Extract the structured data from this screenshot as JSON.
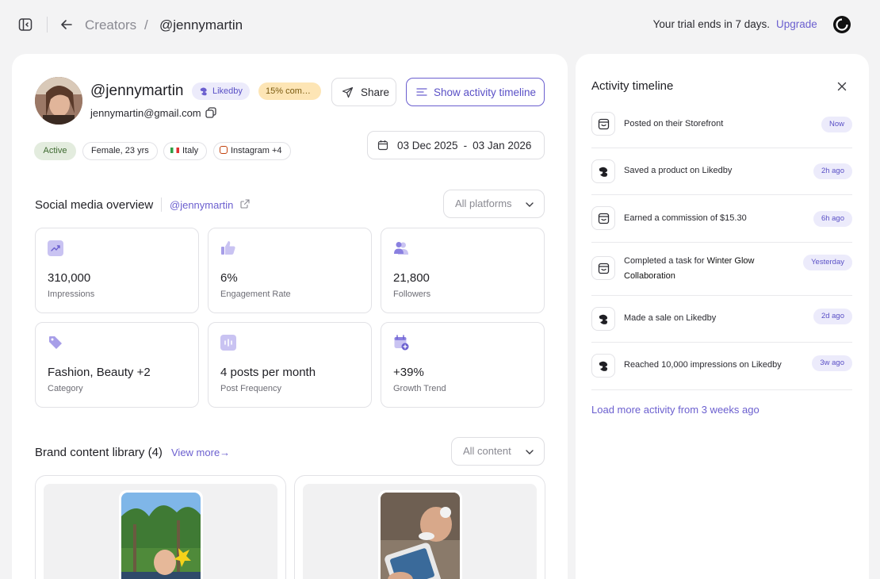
{
  "header": {
    "breadcrumb_parent": "Creators",
    "breadcrumb_separator": "/",
    "breadcrumb_current": "@jennymartin",
    "trial_text": "Your trial ends in 7 days.",
    "upgrade_label": "Upgrade"
  },
  "profile": {
    "handle": "@jennymartin",
    "platform_chip": "Likedby",
    "commission_chip": "15% comm...",
    "email": "jennymartin@gmail.com",
    "share_label": "Share",
    "timeline_label": "Show activity timeline",
    "date_start": "03 Dec 2025",
    "date_sep": "-",
    "date_end": "03 Jan 2026",
    "tags": {
      "status": "Active",
      "gender_age": "Female, 23 yrs",
      "country": "Italy",
      "social": "Instagram +4"
    }
  },
  "social_overview": {
    "title": "Social media overview",
    "handle": "@jennymartin",
    "platform_select": "All platforms",
    "stats": [
      {
        "value": "310,000",
        "label": "Impressions",
        "icon": "trend-icon"
      },
      {
        "value": "6%",
        "label": "Engagement Rate",
        "icon": "thumbs-up-icon"
      },
      {
        "value": "21,800",
        "label": "Followers",
        "icon": "users-icon"
      },
      {
        "value": "Fashion, Beauty +2",
        "label": "Category",
        "icon": "tag-icon"
      },
      {
        "value": "4 posts per month",
        "label": "Post Frequency",
        "icon": "waveform-icon"
      },
      {
        "value": "+39%",
        "label": "Growth Trend",
        "icon": "calendar-plus-icon"
      }
    ]
  },
  "brand_library": {
    "title": "Brand content library (4)",
    "view_more": "View more→",
    "content_select": "All content"
  },
  "timeline": {
    "title": "Activity timeline",
    "items": [
      {
        "text": "Posted on their Storefront",
        "time": "Now",
        "icon": "storefront-icon"
      },
      {
        "text": "Saved a product on Likedby",
        "time": "2h ago",
        "icon": "likedby-icon"
      },
      {
        "text": "Earned a commission of $15.30",
        "time": "6h ago",
        "icon": "storefront-icon"
      },
      {
        "text_prefix": "Completed a task for ",
        "text_bold": "Winter Glow",
        "text_line2": "Collaboration",
        "time": "Yesterday",
        "icon": "storefront-icon"
      },
      {
        "text": "Made a sale on Likedby",
        "time": "2d ago",
        "icon": "likedby-icon"
      },
      {
        "text": "Reached 10,000 impressions on Likedby",
        "time": "3w ago",
        "icon": "likedby-icon"
      }
    ],
    "load_more": "Load more activity from 3 weeks ago"
  },
  "colors": {
    "accent": "#6b5fcf",
    "accent_soft": "#ecebfb",
    "active_green_bg": "#e3ecde",
    "commission_bg": "#fde5b5",
    "page_bg": "#f3f3f4"
  }
}
